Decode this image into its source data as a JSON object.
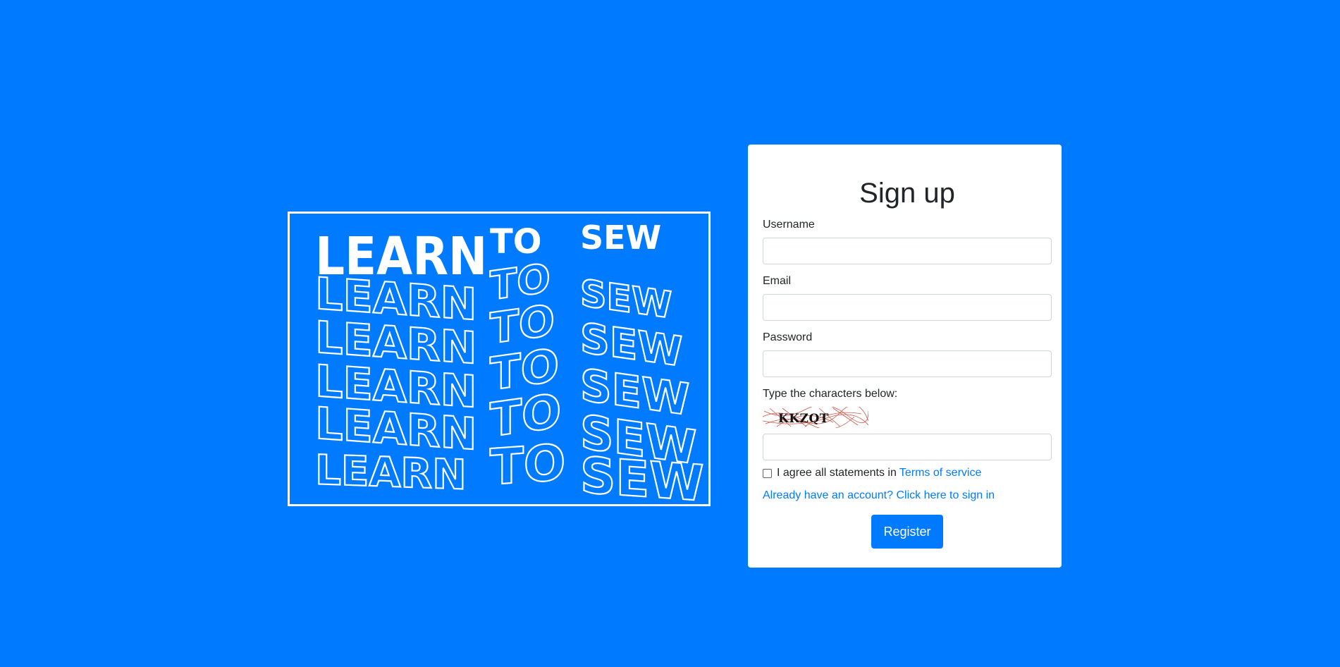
{
  "poster": {
    "line": "LEARN TO SEW",
    "words": [
      "LEARN",
      "TO",
      "SEW"
    ],
    "background_color": "#007bff",
    "foreground_color": "#ffffff"
  },
  "signup": {
    "title": "Sign up",
    "username_label": "Username",
    "username_value": "",
    "email_label": "Email",
    "email_value": "",
    "password_label": "Password",
    "password_value": "",
    "captcha_label": "Type the characters below:",
    "captcha_text": "KKZQT",
    "captcha_value": "",
    "agree_text": "I agree all statements in",
    "agree_checked": false,
    "terms_link": "Terms of service",
    "signin_link": "Already have an account? Click here to sign in",
    "register_button": "Register"
  },
  "colors": {
    "page_background": "#007bff",
    "accent": "#007bff",
    "card_background": "#ffffff",
    "text": "#212529"
  }
}
